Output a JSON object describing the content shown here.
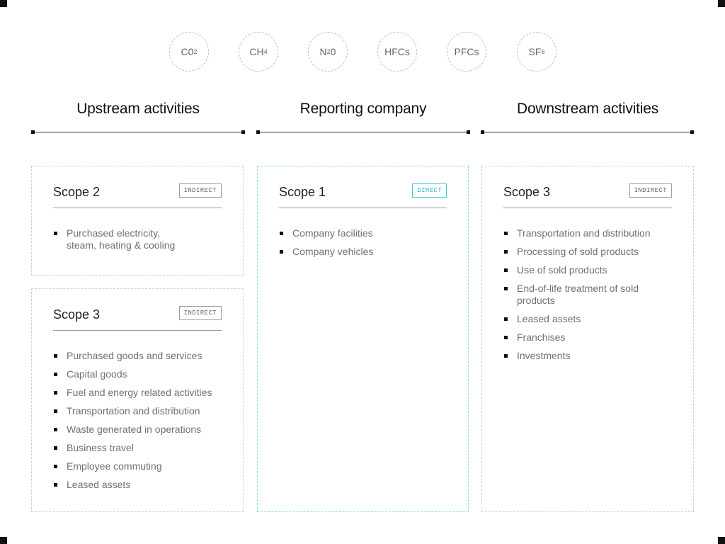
{
  "gases": [
    {
      "base": "C0",
      "sub": "2"
    },
    {
      "base": "CH",
      "sub": "4"
    },
    {
      "base": "N",
      "sub": "2",
      "suffix": "0"
    },
    {
      "base": "HFCs",
      "sub": ""
    },
    {
      "base": "PFCs",
      "sub": ""
    },
    {
      "base": "SF",
      "sub": "6"
    }
  ],
  "columns": {
    "upstream": {
      "title": "Upstream activities"
    },
    "reporting": {
      "title": "Reporting company"
    },
    "downstream": {
      "title": "Downstream activities"
    }
  },
  "cards": {
    "upstream_scope2": {
      "title": "Scope 2",
      "badge": "INDIRECT",
      "items": [
        "Purchased electricity, steam, heating & cooling"
      ]
    },
    "upstream_scope3": {
      "title": "Scope 3",
      "badge": "INDIRECT",
      "items": [
        "Purchased goods and services",
        "Capital goods",
        "Fuel and energy related activities",
        "Transportation and distribution",
        "Waste generated in operations",
        "Business travel",
        "Employee commuting",
        "Leased assets"
      ]
    },
    "reporting_scope1": {
      "title": "Scope 1",
      "badge": "DIRECT",
      "items": [
        "Company facilities",
        "Company vehicles"
      ]
    },
    "downstream_scope3": {
      "title": "Scope 3",
      "badge": "INDIRECT",
      "items": [
        "Transportation and distribution",
        "Processing of sold products",
        "Use of sold products",
        "End-of-life treatment of sold products",
        "Leased assets",
        "Franchises",
        "Investments"
      ]
    }
  },
  "colors": {
    "direct_accent": "#2ab6cc",
    "direct_border": "#8fdde8",
    "text_primary": "#111111",
    "text_secondary": "#707070"
  }
}
